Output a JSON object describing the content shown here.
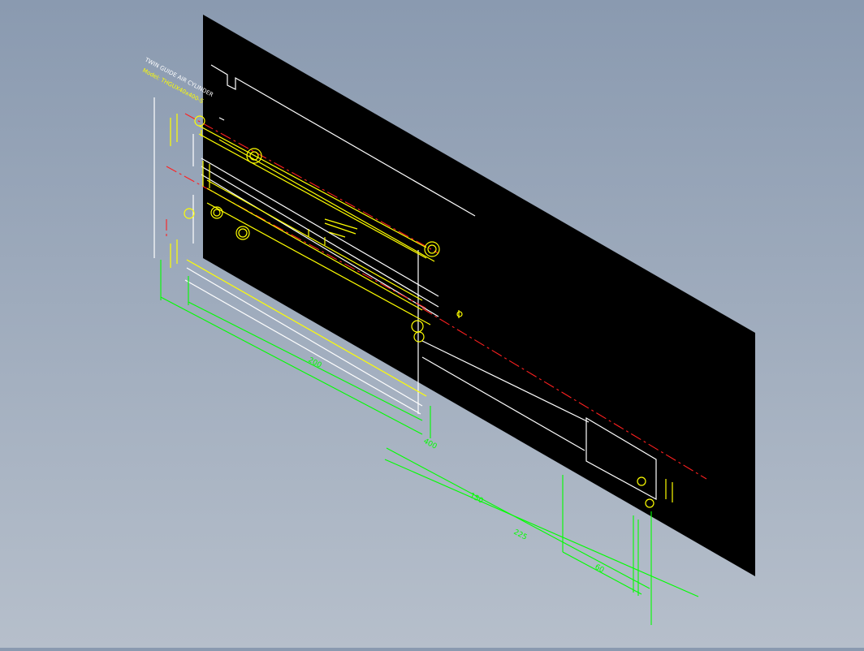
{
  "title_block": {
    "line1": "TWIN GUIDE AIR CYLINDER",
    "line2": "Model: THGUX40x400-S"
  },
  "dimensions": {
    "d_200": "200",
    "d_400": "400",
    "d_150": "150",
    "d_225": "225",
    "d_60": "60"
  },
  "colors": {
    "background_top": "#8a9ab0",
    "background_bottom": "#b6bfcb",
    "sheet": "#000000",
    "outline": "#ffffff",
    "part": "#ffff00",
    "dimension": "#00ff00",
    "center_line": "#ff0000"
  }
}
